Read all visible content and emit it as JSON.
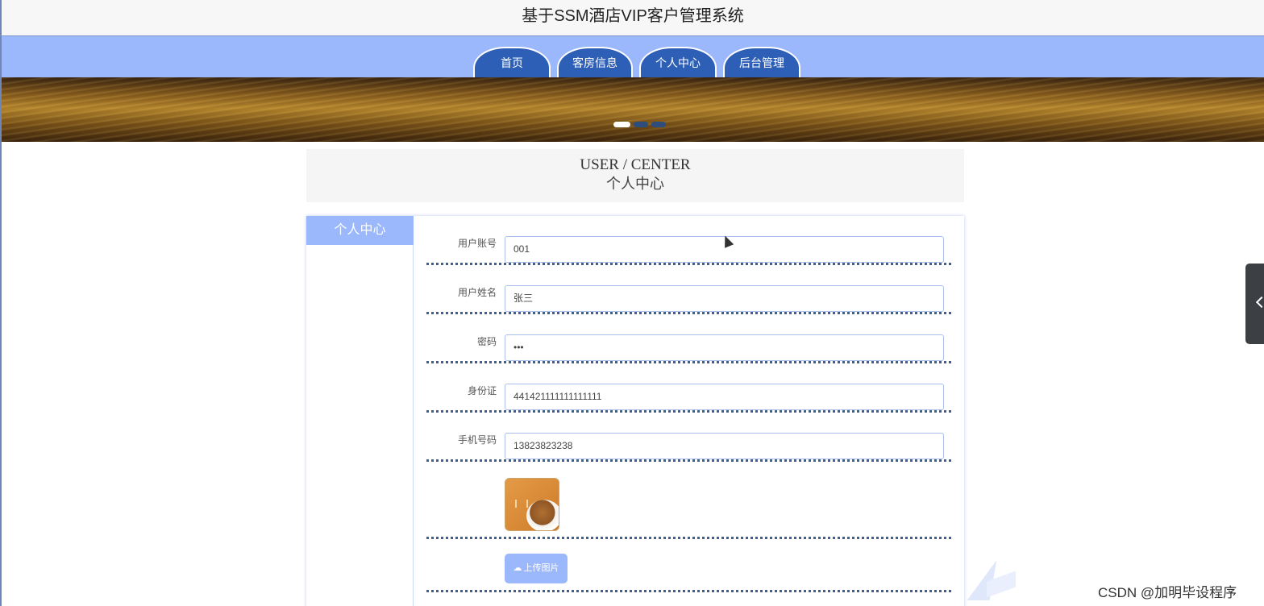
{
  "header": {
    "title": "基于SSM酒店VIP客户管理系统"
  },
  "nav": {
    "items": [
      {
        "label": "首页"
      },
      {
        "label": "客房信息"
      },
      {
        "label": "个人中心"
      },
      {
        "label": "后台管理"
      }
    ]
  },
  "banner": {
    "active_slide": 1,
    "slide_count": 3
  },
  "section": {
    "title_en": "USER / CENTER",
    "title_cn": "个人中心"
  },
  "sidebar": {
    "items": [
      {
        "label": "个人中心"
      }
    ]
  },
  "form": {
    "fields": [
      {
        "label": "用户账号",
        "value": "001"
      },
      {
        "label": "用户姓名",
        "value": "张三"
      },
      {
        "label": "密码",
        "value": "•••"
      },
      {
        "label": "身份证",
        "value": "441421111111111111"
      },
      {
        "label": "手机号码",
        "value": "13823823238"
      }
    ],
    "upload_label": "上传图片"
  },
  "watermark": "CSDN @加明毕设程序",
  "colors": {
    "nav_bg": "#9ab8fb",
    "nav_item": "#2e5fb7",
    "accent": "#9ab8fb"
  }
}
